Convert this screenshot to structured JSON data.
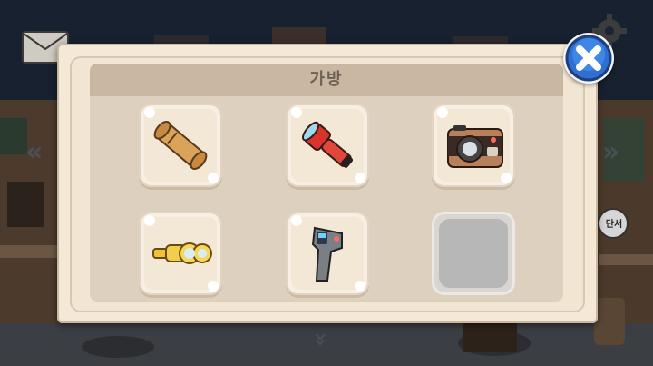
{
  "inventory": {
    "title": "가방",
    "items": [
      {
        "icon": "scroll-icon"
      },
      {
        "icon": "flashlight-icon"
      },
      {
        "icon": "camera-icon"
      },
      {
        "icon": "spyglass-icon"
      },
      {
        "icon": "thermometer-gun-icon"
      },
      {
        "icon": "empty-slot"
      }
    ]
  },
  "hud": {
    "sign_text": "단서"
  },
  "colors": {
    "panel": "#f4e8d6",
    "title_bar": "#c9b7a2",
    "close_button": "#2f6fd0"
  }
}
